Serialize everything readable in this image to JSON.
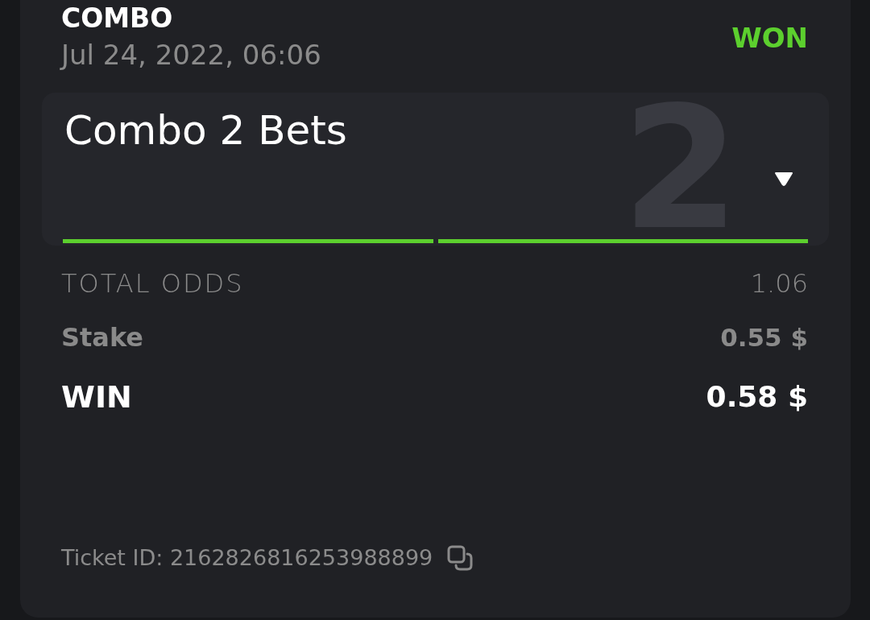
{
  "header": {
    "bet_type": "COMBO",
    "date": "Jul 24, 2022, 06:06",
    "status": "WON",
    "won": true
  },
  "combo": {
    "title": "Combo 2 Bets",
    "count": "2",
    "expanded": false,
    "legs": [
      {
        "won": true
      },
      {
        "won": true
      }
    ]
  },
  "summary": [
    {
      "kind": "odds",
      "label": "TOTAL ODDS",
      "value": "1.06"
    },
    {
      "kind": "stake",
      "label": "Stake",
      "value": "0.55 $"
    },
    {
      "kind": "win",
      "label": "WIN",
      "value": "0.58 $"
    }
  ],
  "ticket_id": "Ticket ID: 2162826816253988899"
}
